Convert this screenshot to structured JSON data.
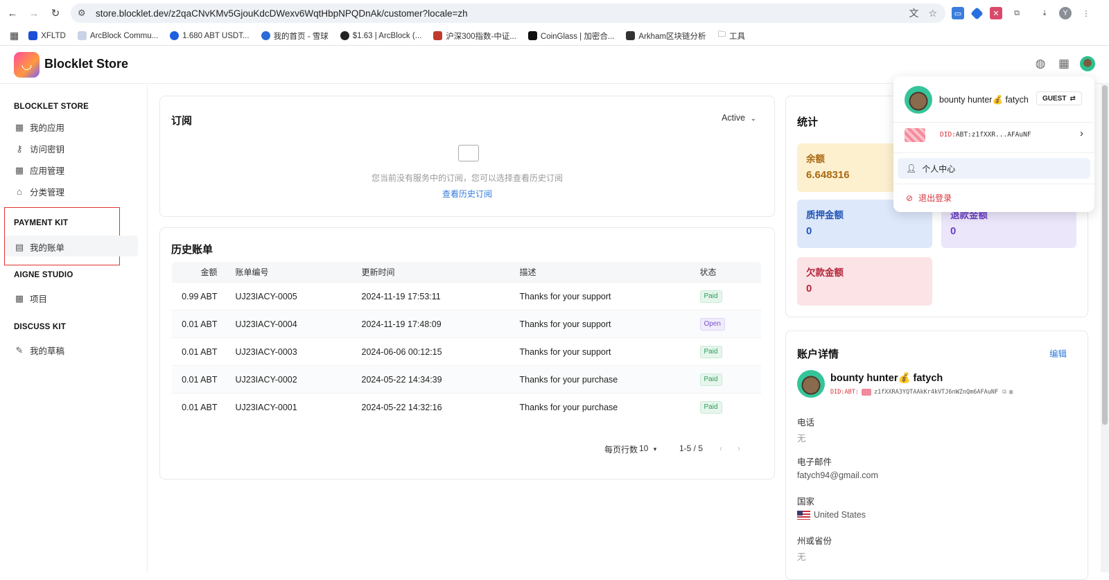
{
  "browser": {
    "url": "store.blocklet.dev/z2qaCNvKMv5GjouKdcDWexv6WqtHbpNPQDnAk/customer?locale=zh",
    "profile_initial": "Y",
    "bookmarks": [
      "XFLTD",
      "ArcBlock Commu...",
      "1.680 ABT USDT...",
      "我的首页 - 雪球",
      "$1.63 | ArcBlock (...",
      "沪深300指数-中证...",
      "CoinGlass | 加密合...",
      "Arkham区块链分析",
      "工具"
    ]
  },
  "header": {
    "brand": "Blocklet Store"
  },
  "sidebar": {
    "sections": [
      {
        "title": "BLOCKLET STORE",
        "items": [
          "我的应用",
          "访问密钥",
          "应用管理",
          "分类管理"
        ]
      },
      {
        "title": "PAYMENT KIT",
        "items": [
          "我的账单"
        ]
      },
      {
        "title": "AIGNE STUDIO",
        "items": [
          "项目"
        ]
      },
      {
        "title": "DISCUSS KIT",
        "items": [
          "我的草稿"
        ]
      }
    ]
  },
  "subscriptions": {
    "title": "订阅",
    "filter": "Active",
    "empty_text": "您当前没有服务中的订阅，您可以选择查看历史订阅",
    "history_link": "查看历史订阅"
  },
  "invoices": {
    "title": "历史账单",
    "columns": [
      "金额",
      "账单编号",
      "更新时间",
      "描述",
      "状态"
    ],
    "rows": [
      {
        "amount": "0.99 ABT",
        "number": "UJ23IACY-0005",
        "time": "2024-11-19 17:53:11",
        "desc": "Thanks for your support",
        "status": "Paid"
      },
      {
        "amount": "0.01 ABT",
        "number": "UJ23IACY-0004",
        "time": "2024-11-19 17:48:09",
        "desc": "Thanks for your support",
        "status": "Open"
      },
      {
        "amount": "0.01 ABT",
        "number": "UJ23IACY-0003",
        "time": "2024-06-06 00:12:15",
        "desc": "Thanks for your support",
        "status": "Paid"
      },
      {
        "amount": "0.01 ABT",
        "number": "UJ23IACY-0002",
        "time": "2024-05-22 14:34:39",
        "desc": "Thanks for your purchase",
        "status": "Paid"
      },
      {
        "amount": "0.01 ABT",
        "number": "UJ23IACY-0001",
        "time": "2024-05-22 14:32:16",
        "desc": "Thanks for your purchase",
        "status": "Paid"
      }
    ],
    "rows_per_page_label": "每页行数",
    "rows_per_page": "10",
    "range": "1-5 / 5"
  },
  "stats": {
    "title": "统计",
    "balance_label": "余额",
    "balance": "6.648316",
    "staked_label": "质押金额",
    "staked": "0",
    "refund_label": "退款金额",
    "refund": "0",
    "due_label": "欠款金额",
    "due": "0"
  },
  "account": {
    "title": "账户详情",
    "edit": "编辑",
    "name": "bounty hunter💰 fatych",
    "did_prefix": "DID:ABT:",
    "did": "z1fXXRA3YQTAAkKr4kVTJ6nWZnQm6AFAuNF",
    "phone_label": "电话",
    "phone": "无",
    "email_label": "电子邮件",
    "email": "fatych94@gmail.com",
    "country_label": "国家",
    "country": "United States",
    "state_label": "州或省份",
    "state": "无"
  },
  "user_menu": {
    "name": "bounty hunter💰 fatych",
    "role": "GUEST",
    "did_prefix": "DID:",
    "did_short": "ABT:z1fXXR...AFAuNF",
    "profile": "个人中心",
    "logout": "退出登录"
  },
  "colors": {
    "accent": "#2f7bdc",
    "logout": "#d8323b",
    "balance_bg": "#fdf0cf",
    "staked_bg": "#dde8fb",
    "refund_bg": "#ece6fb",
    "due_bg": "#fbe3e6"
  }
}
